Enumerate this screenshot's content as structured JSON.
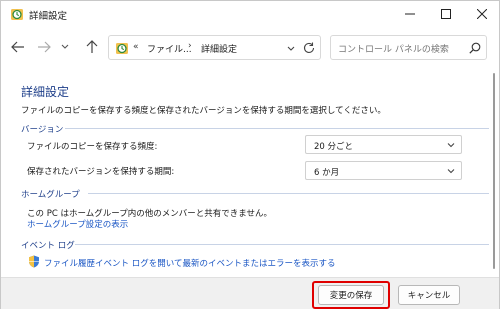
{
  "window": {
    "title": "詳細設定",
    "controls": {
      "minimize": "—",
      "maximize": "☐",
      "close": "✕"
    }
  },
  "nav": {
    "back_icon": "arrow-left-icon",
    "forward_icon": "arrow-right-icon",
    "recent_icon": "chevron-down-icon",
    "up_icon": "arrow-up-icon",
    "address": {
      "overflow": "«",
      "part1": "ファイル...",
      "separator": "›",
      "part2": "詳細設定"
    },
    "search": {
      "placeholder": "コントロール パネルの検索"
    }
  },
  "main": {
    "title": "詳細設定",
    "description": "ファイルのコピーを保存する頻度と保存されたバージョンを保持する期間を選択してください。",
    "versions": {
      "heading": "バージョン",
      "frequency_label": "ファイルのコピーを保存する頻度:",
      "frequency_value": "20 分ごと",
      "retention_label": "保存されたバージョンを保持する期間:",
      "retention_value": "6 か月"
    },
    "homegroup": {
      "heading": "ホームグループ",
      "text": "この PC はホームグループ内の他のメンバーと共有できません。",
      "link": "ホームグループ設定の表示"
    },
    "eventlog": {
      "heading": "イベント ログ",
      "link": "ファイル履歴イベント ログを開いて最新のイベントまたはエラーを表示する"
    }
  },
  "footer": {
    "save_label": "変更の保存",
    "cancel_label": "キャンセル"
  },
  "colors": {
    "accent_heading": "#1e3f8a",
    "link": "#1a56c4",
    "highlight": "#e00000"
  }
}
